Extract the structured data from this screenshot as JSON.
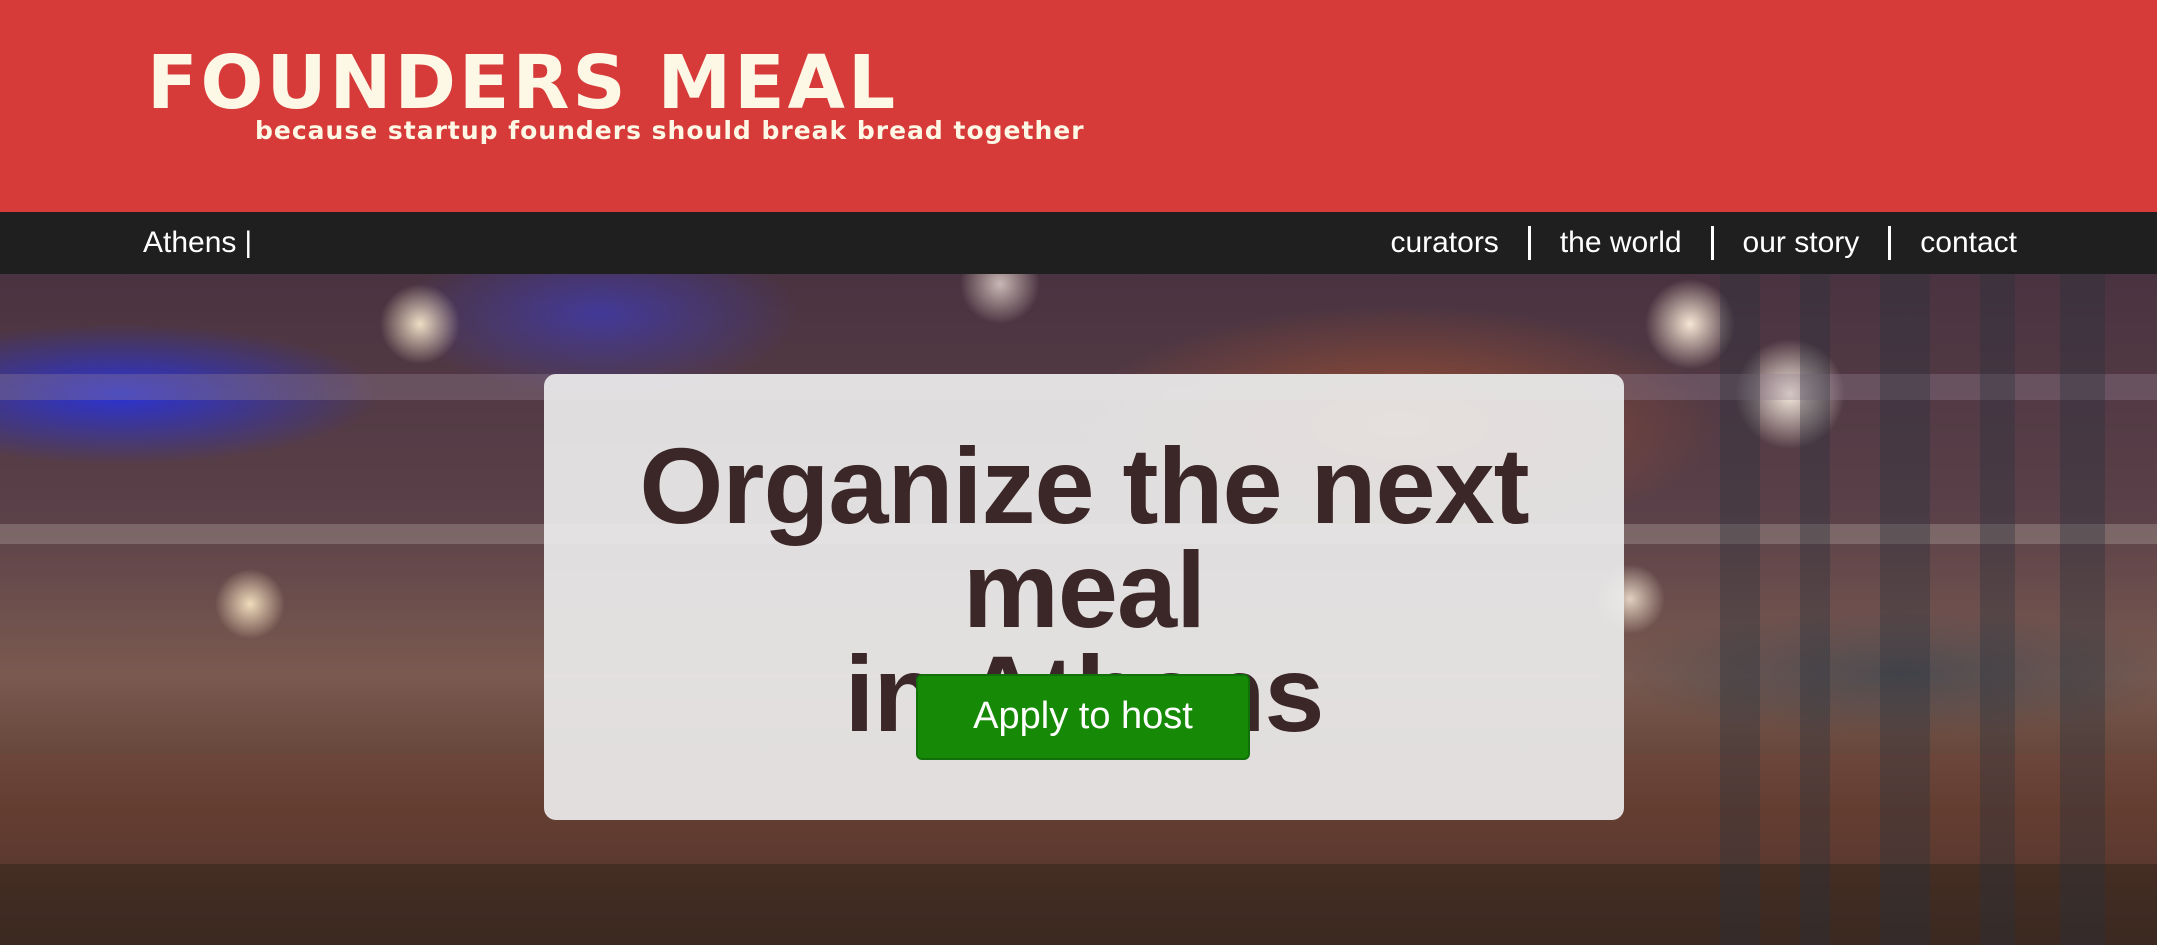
{
  "header": {
    "logo_title": "FOUNDERS MEAL",
    "tagline": "because startup founders should break bread together",
    "background_color": "#d63b3a",
    "text_color": "#fdf8e6"
  },
  "nav": {
    "city_label": "Athens",
    "city_separator": "|",
    "links": [
      {
        "label": "curators"
      },
      {
        "label": "the world"
      },
      {
        "label": "our story"
      },
      {
        "label": "contact"
      }
    ],
    "background_color": "#1f1f1f"
  },
  "hero": {
    "headline_line1": "Organize the next meal",
    "headline_line2": "in Athens",
    "cta_label": "Apply to host",
    "cta_color": "#168a06",
    "headline_color": "#3b2628"
  }
}
